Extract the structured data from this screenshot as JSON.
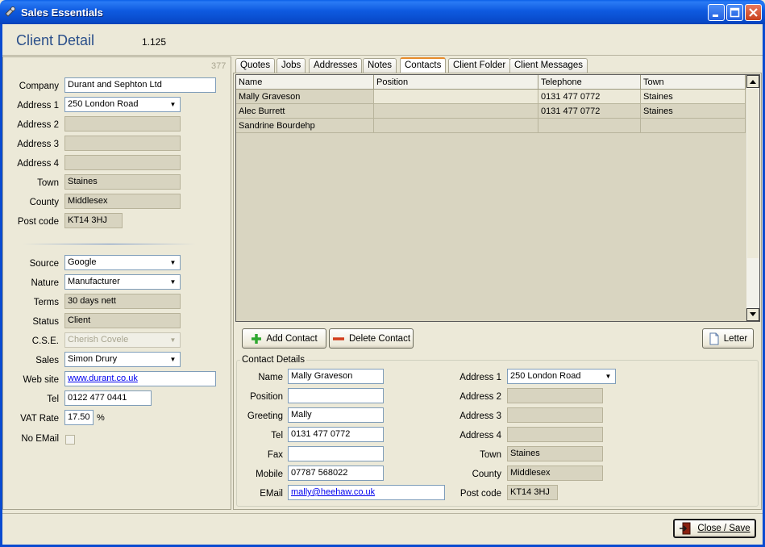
{
  "window": {
    "title": "Sales Essentials"
  },
  "header": {
    "title": "Client Detail",
    "version": "1.125"
  },
  "client": {
    "record_id": "377",
    "labels": {
      "company": "Company",
      "address1": "Address 1",
      "address2": "Address 2",
      "address3": "Address 3",
      "address4": "Address 4",
      "town": "Town",
      "county": "County",
      "postcode": "Post code",
      "source": "Source",
      "nature": "Nature",
      "terms": "Terms",
      "status": "Status",
      "cse": "C.S.E.",
      "sales": "Sales",
      "website": "Web site",
      "tel": "Tel",
      "vat": "VAT Rate",
      "noemail": "No EMail"
    },
    "values": {
      "company": "Durant and Sephton Ltd",
      "address1": "250 London Road",
      "address2": "",
      "address3": "",
      "address4": "",
      "town": "Staines",
      "county": "Middlesex",
      "postcode": "KT14 3HJ",
      "source": "Google",
      "nature": "Manufacturer",
      "terms": "30 days nett",
      "status": "Client",
      "cse": "Cherish Covele",
      "sales": "Simon Drury",
      "website": "www.durant.co.uk",
      "tel": "0122 477 0441",
      "vat": "17.50",
      "vat_unit": "%"
    },
    "no_email_checked": false
  },
  "tabs": [
    "Quotes",
    "Jobs",
    "Addresses",
    "Notes",
    "Contacts",
    "Client Folder",
    "Client Messages"
  ],
  "active_tab": "Contacts",
  "contacts_grid": {
    "columns": [
      "Name",
      "Position",
      "Telephone",
      "Town"
    ],
    "rows": [
      {
        "name": "Mally Graveson",
        "position": "",
        "telephone": "0131 477 0772",
        "town": "Staines"
      },
      {
        "name": "Alec Burrett",
        "position": "",
        "telephone": "0131 477 0772",
        "town": "Staines"
      },
      {
        "name": "Sandrine Bourdehp",
        "position": "",
        "telephone": "",
        "town": ""
      }
    ]
  },
  "buttons": {
    "add_contact": "Add Contact",
    "delete_contact": "Delete Contact",
    "letter": "Letter",
    "close_save": "Close / Save"
  },
  "contact_details": {
    "group_title": "Contact Details",
    "labels": {
      "name": "Name",
      "position": "Position",
      "greeting": "Greeting",
      "tel": "Tel",
      "fax": "Fax",
      "mobile": "Mobile",
      "email": "EMail",
      "address1": "Address 1",
      "address2": "Address 2",
      "address3": "Address 3",
      "address4": "Address 4",
      "town": "Town",
      "county": "County",
      "postcode": "Post code"
    },
    "values": {
      "name": "Mally Graveson",
      "position": "",
      "greeting": "Mally",
      "tel": "0131 477 0772",
      "fax": "",
      "mobile": "07787 568022",
      "email": "mally@heehaw.co.uk",
      "address1": "250 London Road",
      "address2": "",
      "address3": "",
      "address4": "",
      "town": "Staines",
      "county": "Middlesex",
      "postcode": "KT14 3HJ"
    }
  }
}
